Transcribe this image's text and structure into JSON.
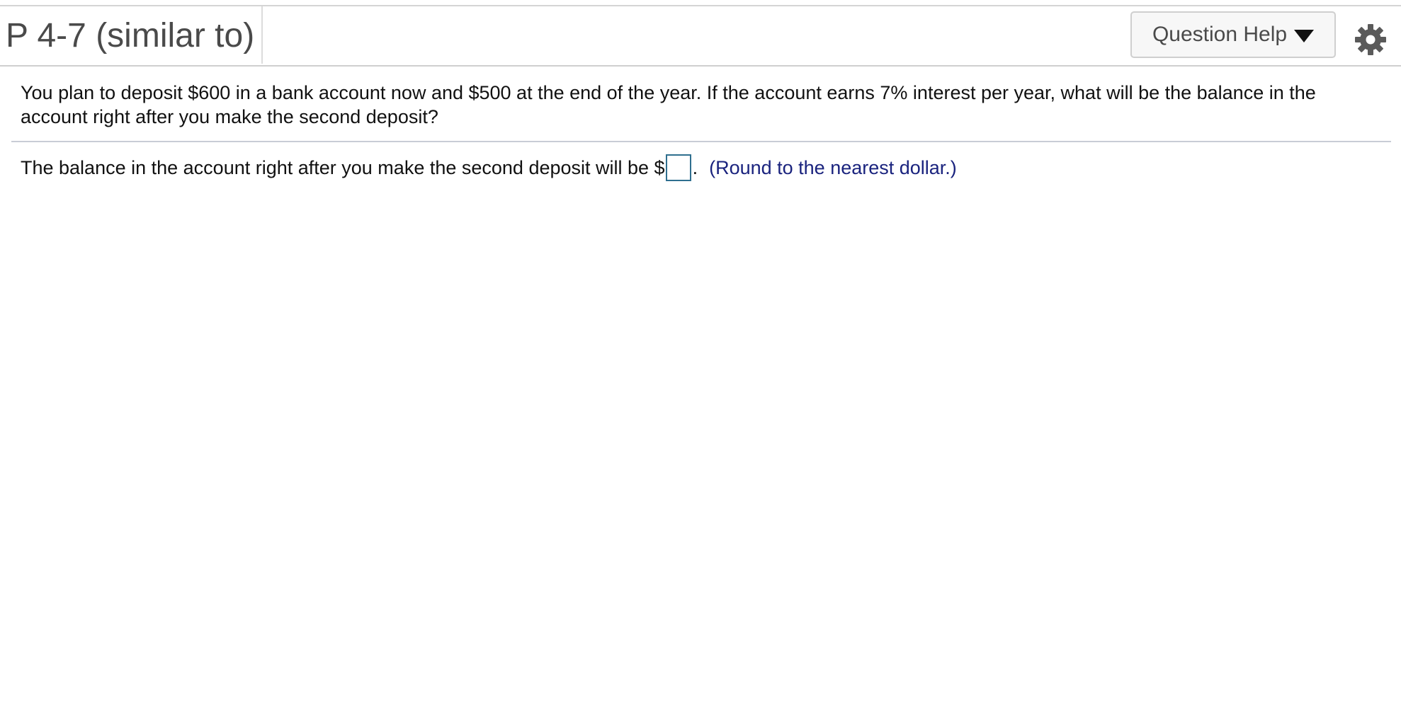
{
  "header": {
    "title": "P 4-7 (similar to)",
    "help_button_label": "Question Help"
  },
  "question": {
    "prompt": "You plan to deposit $600 in a bank account now and $500 at the end of the year. If the account earns 7% interest per year, what will be the balance in the account right after you make the second deposit?",
    "answer_prefix": "The balance in the account right after you make the second deposit will be $",
    "answer_value": "",
    "answer_suffix": ".",
    "hint": "(Round to the nearest dollar.)"
  },
  "icons": {
    "help_caret": "caret-down-icon",
    "settings": "gear-icon"
  },
  "colors": {
    "hint_text": "#1a237e",
    "input_border": "#2f6f8f"
  }
}
